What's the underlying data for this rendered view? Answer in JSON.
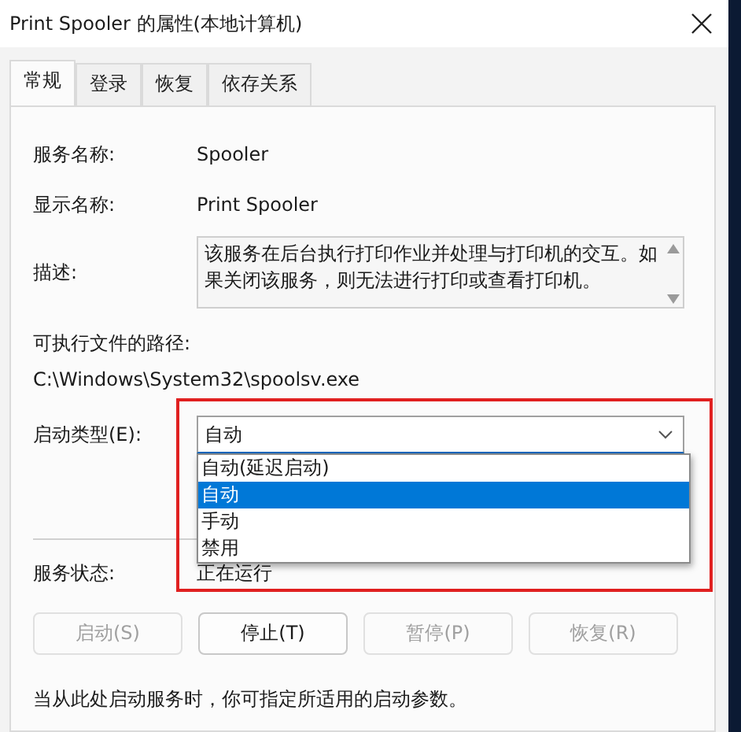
{
  "window": {
    "title": "Print Spooler 的属性(本地计算机)"
  },
  "tabs": [
    {
      "label": "常规",
      "selected": true
    },
    {
      "label": "登录",
      "selected": false
    },
    {
      "label": "恢复",
      "selected": false
    },
    {
      "label": "依存关系",
      "selected": false
    }
  ],
  "fields": [
    {
      "label": "服务名称:",
      "value": "Spooler"
    },
    {
      "label": "显示名称:",
      "value": "Print Spooler"
    }
  ],
  "description": {
    "label": "描述:",
    "value": "该服务在后台执行打印作业并处理与打印机的交互。如果关闭该服务，则无法进行打印或查看打印机。"
  },
  "path": {
    "label": "可执行文件的路径:",
    "value": "C:\\Windows\\System32\\spoolsv.exe"
  },
  "startup": {
    "label": "启动类型(E):",
    "value": "自动",
    "expanded": true,
    "options": [
      {
        "label": "自动(延迟启动)",
        "selected": false
      },
      {
        "label": "自动",
        "selected": true
      },
      {
        "label": "手动",
        "selected": false
      },
      {
        "label": "禁用",
        "selected": false
      }
    ]
  },
  "status": {
    "label": "服务状态:",
    "value": "正在运行"
  },
  "buttons": [
    {
      "label": "启动(S)",
      "disabled": true
    },
    {
      "label": "停止(T)",
      "disabled": false
    },
    {
      "label": "暂停(P)",
      "disabled": true
    },
    {
      "label": "恢复(R)",
      "disabled": true
    }
  ],
  "hint": "当从此处启动服务时，你可指定所适用的启动参数。"
}
